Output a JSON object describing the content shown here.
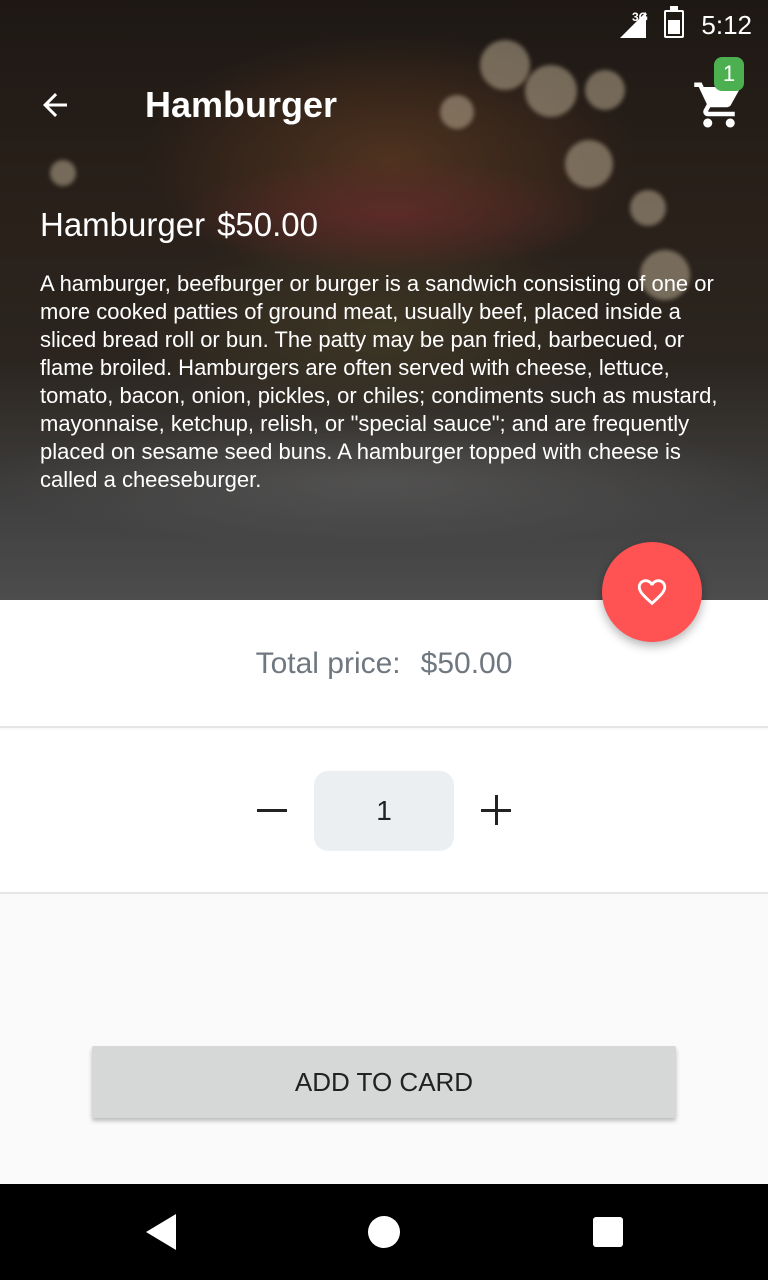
{
  "status_bar": {
    "network": "3G",
    "time": "5:12"
  },
  "app_bar": {
    "title": "Hamburger",
    "cart_count": "1"
  },
  "product": {
    "name": "Hamburger",
    "price": "$50.00",
    "description": "A hamburger, beefburger or burger is a sandwich consisting of one or more cooked patties of ground meat, usually beef, placed inside a sliced bread roll or bun. The patty may be pan fried, barbecued, or flame broiled. Hamburgers are often served with cheese, lettuce, tomato, bacon, onion, pickles, or chiles; condiments such as mustard, mayonnaise, ketchup, relish, or \"special sauce\"; and are frequently placed on sesame seed buns. A hamburger topped with cheese is called a cheeseburger."
  },
  "total": {
    "label": "Total price:",
    "value": "$50.00"
  },
  "quantity": {
    "value": "1"
  },
  "actions": {
    "add_label": "ADD TO CARD"
  },
  "icons": {
    "back": "arrow-left-icon",
    "cart": "shopping-cart-icon",
    "favorite": "heart-outline-icon",
    "minus": "minus-icon",
    "plus": "plus-icon"
  },
  "colors": {
    "fab": "#ff5252",
    "badge": "#4caf50",
    "price_text": "#6f7880",
    "qty_box": "#eceff1",
    "button": "#d6d7d7"
  }
}
